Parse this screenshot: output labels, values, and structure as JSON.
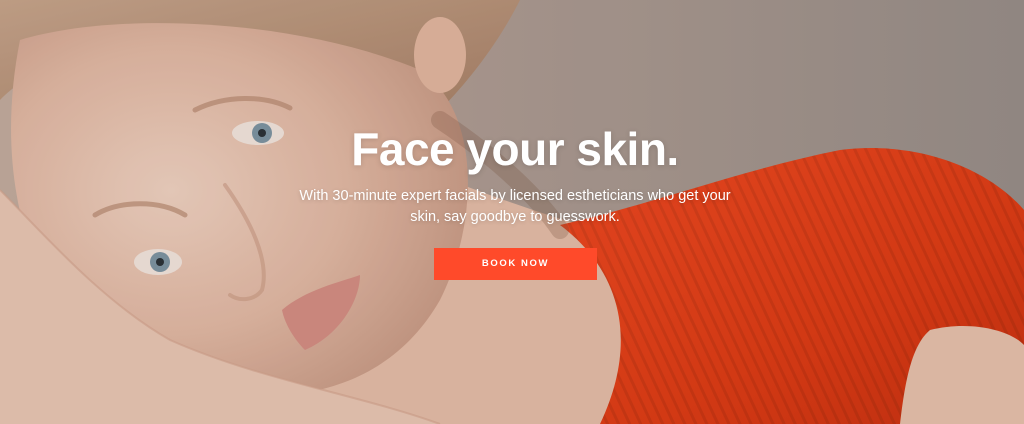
{
  "hero": {
    "headline": "Face your skin.",
    "subhead": "With 30-minute expert facials by licensed estheticians who get your skin, say goodbye to guesswork.",
    "cta_label": "BOOK NOW"
  },
  "colors": {
    "cta_background": "#ff4a2a",
    "text": "#ffffff",
    "shirt": "#e8401b",
    "backdrop": "#a89b93"
  }
}
